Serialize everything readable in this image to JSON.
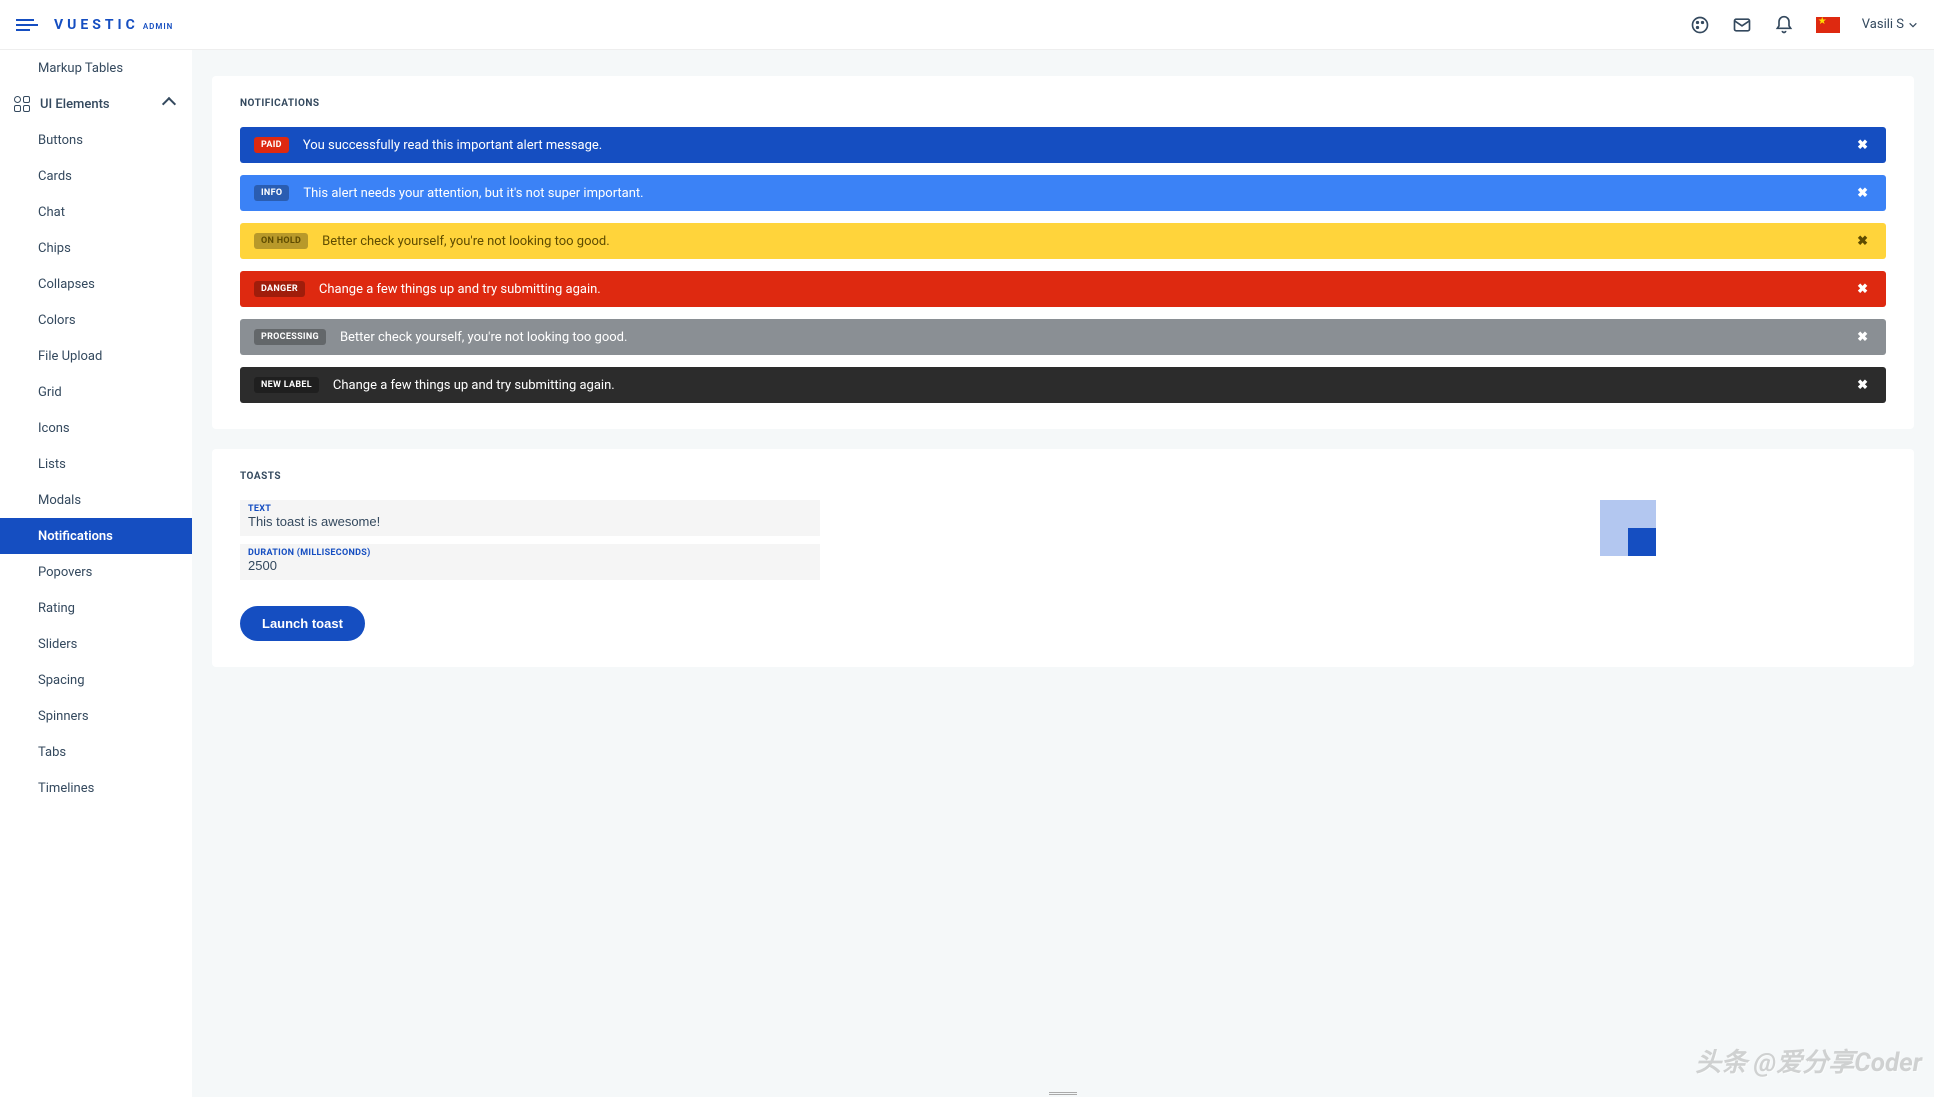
{
  "brand": {
    "name": "VUESTIC",
    "suffix": "ADMIN"
  },
  "user": {
    "name": "Vasili S"
  },
  "sidebar": {
    "topItem": "Markup Tables",
    "group": "UI Elements",
    "items": [
      "Buttons",
      "Cards",
      "Chat",
      "Chips",
      "Collapses",
      "Colors",
      "File Upload",
      "Grid",
      "Icons",
      "Lists",
      "Modals",
      "Notifications",
      "Popovers",
      "Rating",
      "Sliders",
      "Spacing",
      "Spinners",
      "Tabs",
      "Timelines"
    ],
    "active": "Notifications"
  },
  "notifications": {
    "title": "NOTIFICATIONS",
    "alerts": [
      {
        "badge": "PAID",
        "text": "You successfully read this important alert message.",
        "class": "paid"
      },
      {
        "badge": "INFO",
        "text": "This alert needs your attention, but it's not super important.",
        "class": "info"
      },
      {
        "badge": "ON HOLD",
        "text": "Better check yourself, you're not looking too good.",
        "class": "onhold"
      },
      {
        "badge": "DANGER",
        "text": "Change a few things up and try submitting again.",
        "class": "danger"
      },
      {
        "badge": "PROCESSING",
        "text": "Better check yourself, you're not looking too good.",
        "class": "processing"
      },
      {
        "badge": "NEW LABEL",
        "text": "Change a few things up and try submitting again.",
        "class": "newlabel"
      }
    ]
  },
  "toasts": {
    "title": "TOASTS",
    "textLabel": "TEXT",
    "textValue": "This toast is awesome!",
    "durationLabel": "DURATION (MILLISECONDS)",
    "durationValue": "2500",
    "position": "bottom-right",
    "launchButton": "Launch toast"
  },
  "watermark": "头条 @爱分享Coder"
}
